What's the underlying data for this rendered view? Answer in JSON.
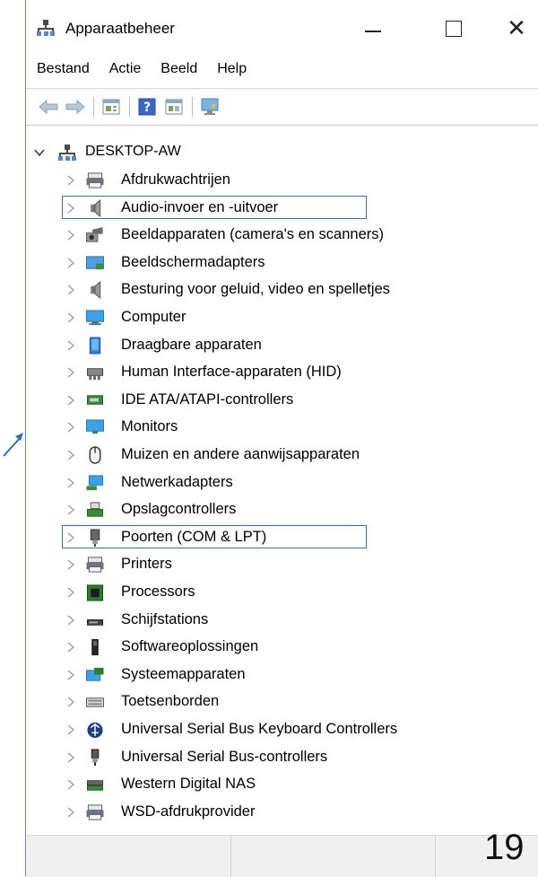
{
  "window": {
    "title": "Apparaatbeheer"
  },
  "menu": [
    "Bestand",
    "Actie",
    "Beeld",
    "Help"
  ],
  "toolbar": {
    "icons": [
      "back-arrow-icon",
      "forward-arrow-icon",
      "properties-icon",
      "help-icon",
      "update-driver-icon",
      "scan-hardware-icon"
    ]
  },
  "tree": {
    "root": "DESKTOP-AW",
    "categories": [
      {
        "label": "Afdrukwachtrijen",
        "icon": "print-queue-icon"
      },
      {
        "label": "Audio-invoer en -uitvoer",
        "icon": "speaker-icon",
        "highlighted": true
      },
      {
        "label": "Beeldapparaten (camera's en scanners)",
        "icon": "camera-icon"
      },
      {
        "label": "Beeldschermadapters",
        "icon": "display-adapter-icon"
      },
      {
        "label": "Besturing voor geluid, video en spelletjes",
        "icon": "speaker-icon"
      },
      {
        "label": "Computer",
        "icon": "computer-icon"
      },
      {
        "label": "Draagbare apparaten",
        "icon": "portable-device-icon"
      },
      {
        "label": "Human Interface-apparaten (HID)",
        "icon": "hid-icon"
      },
      {
        "label": "IDE ATA/ATAPI-controllers",
        "icon": "ide-controller-icon"
      },
      {
        "label": "Monitors",
        "icon": "monitor-icon"
      },
      {
        "label": "Muizen en andere aanwijsapparaten",
        "icon": "mouse-icon"
      },
      {
        "label": "Netwerkadapters",
        "icon": "network-adapter-icon"
      },
      {
        "label": "Opslagcontrollers",
        "icon": "storage-controller-icon"
      },
      {
        "label": "Poorten (COM & LPT)",
        "icon": "port-icon",
        "highlighted": true
      },
      {
        "label": "Printers",
        "icon": "printer-icon"
      },
      {
        "label": "Processors",
        "icon": "processor-icon"
      },
      {
        "label": "Schijfstations",
        "icon": "disk-drive-icon"
      },
      {
        "label": "Softwareoplossingen",
        "icon": "software-icon"
      },
      {
        "label": "Systeemapparaten",
        "icon": "system-device-icon"
      },
      {
        "label": "Toetsenborden",
        "icon": "keyboard-icon"
      },
      {
        "label": "Universal Serial Bus Keyboard Controllers",
        "icon": "usb-hub-icon"
      },
      {
        "label": "Universal Serial Bus-controllers",
        "icon": "usb-icon"
      },
      {
        "label": "Western Digital NAS",
        "icon": "nas-icon"
      },
      {
        "label": "WSD-afdrukprovider",
        "icon": "print-queue-icon"
      }
    ]
  },
  "slide": {
    "number": "19"
  },
  "colors": {
    "highlight_border": "#3b6ea8",
    "window_border": "#5b8fc9"
  }
}
